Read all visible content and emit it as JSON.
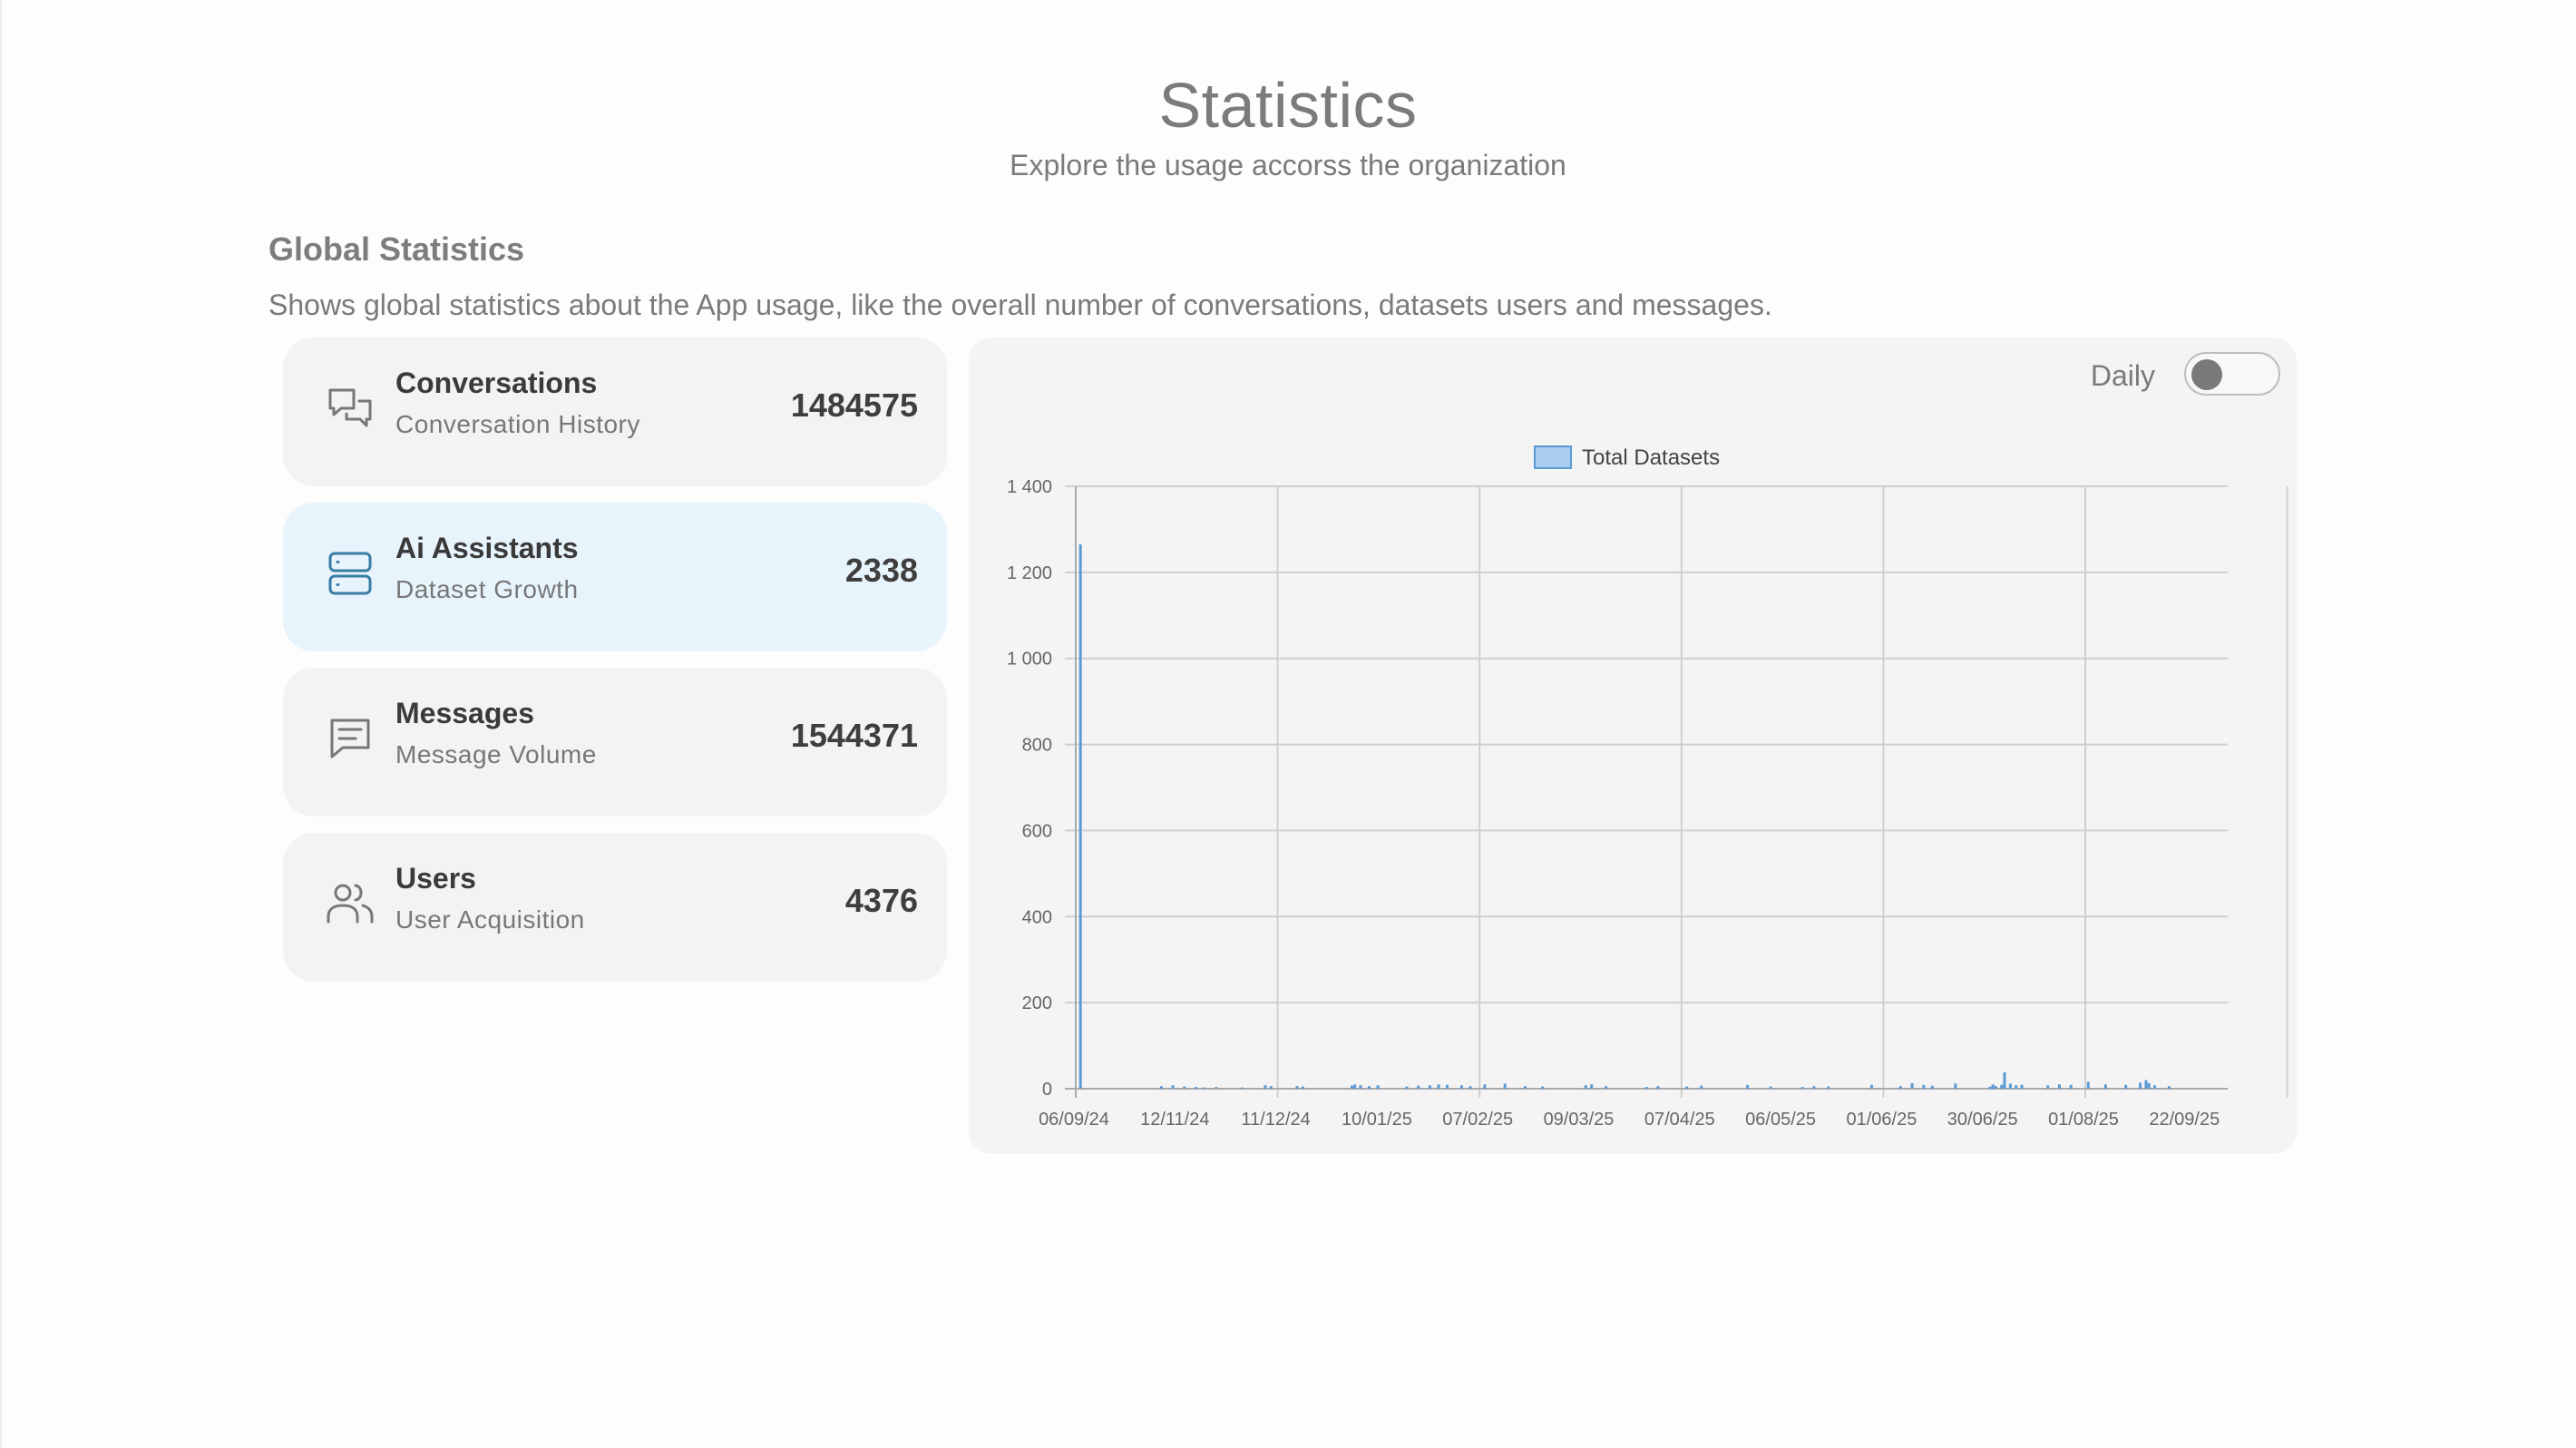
{
  "header": {
    "title": "Statistics",
    "subtitle": "Explore the usage accorss the organization"
  },
  "section": {
    "title": "Global Statistics",
    "description": "Shows global statistics about the App usage, like the overall number of conversations, datasets users and messages."
  },
  "stats": [
    {
      "title": "Conversations",
      "subtitle": "Conversation History",
      "value": "1484575",
      "icon": "conversations-icon",
      "selected": false
    },
    {
      "title": "Ai Assistants",
      "subtitle": "Dataset Growth",
      "value": "2338",
      "icon": "server-icon",
      "selected": true
    },
    {
      "title": "Messages",
      "subtitle": "Message Volume",
      "value": "1544371",
      "icon": "message-icon",
      "selected": false
    },
    {
      "title": "Users",
      "subtitle": "User Acquisition",
      "value": "4376",
      "icon": "users-icon",
      "selected": false
    }
  ],
  "toggle": {
    "label": "Daily",
    "on": false
  },
  "colors": {
    "accent": "#5b9bd5",
    "selected_card": "#e8f4fc",
    "icon_selected": "#3a7ca5"
  },
  "chart_data": {
    "type": "bar",
    "legend": "Total Datasets",
    "legend_position": "top-center",
    "grid": true,
    "ylim": [
      0,
      1400
    ],
    "yticks": [
      "0",
      "200",
      "400",
      "600",
      "800",
      "1 000",
      "1 200",
      "1 400"
    ],
    "xticks": [
      "06/09/24",
      "12/11/24",
      "11/12/24",
      "10/01/25",
      "07/02/25",
      "09/03/25",
      "07/04/25",
      "06/05/25",
      "01/06/25",
      "30/06/25",
      "01/08/25",
      "22/09/25"
    ],
    "x_range_days": [
      0,
      392
    ],
    "bars": [
      [
        1,
        1265
      ],
      [
        29,
        6
      ],
      [
        33,
        8
      ],
      [
        37,
        5
      ],
      [
        41,
        4
      ],
      [
        44,
        3
      ],
      [
        48,
        4
      ],
      [
        57,
        3
      ],
      [
        65,
        8
      ],
      [
        67,
        6
      ],
      [
        76,
        6
      ],
      [
        78,
        5
      ],
      [
        95,
        7
      ],
      [
        96,
        10
      ],
      [
        98,
        8
      ],
      [
        101,
        6
      ],
      [
        104,
        8
      ],
      [
        114,
        5
      ],
      [
        118,
        7
      ],
      [
        122,
        8
      ],
      [
        125,
        10
      ],
      [
        128,
        9
      ],
      [
        133,
        8
      ],
      [
        136,
        6
      ],
      [
        141,
        10
      ],
      [
        148,
        12
      ],
      [
        155,
        6
      ],
      [
        161,
        5
      ],
      [
        176,
        8
      ],
      [
        178,
        10
      ],
      [
        183,
        6
      ],
      [
        197,
        4
      ],
      [
        201,
        6
      ],
      [
        211,
        5
      ],
      [
        216,
        7
      ],
      [
        232,
        9
      ],
      [
        240,
        5
      ],
      [
        251,
        4
      ],
      [
        255,
        6
      ],
      [
        260,
        5
      ],
      [
        275,
        9
      ],
      [
        285,
        6
      ],
      [
        289,
        13
      ],
      [
        293,
        9
      ],
      [
        296,
        7
      ],
      [
        304,
        12
      ],
      [
        316,
        5
      ],
      [
        317,
        4
      ],
      [
        317,
        10
      ],
      [
        318,
        6
      ],
      [
        320,
        9
      ],
      [
        321,
        38
      ],
      [
        323,
        12
      ],
      [
        325,
        8
      ],
      [
        327,
        9
      ],
      [
        336,
        8
      ],
      [
        340,
        10
      ],
      [
        344,
        9
      ],
      [
        350,
        16
      ],
      [
        356,
        10
      ],
      [
        363,
        9
      ],
      [
        368,
        14
      ],
      [
        370,
        20
      ],
      [
        371,
        13
      ],
      [
        373,
        8
      ],
      [
        378,
        6
      ]
    ]
  }
}
